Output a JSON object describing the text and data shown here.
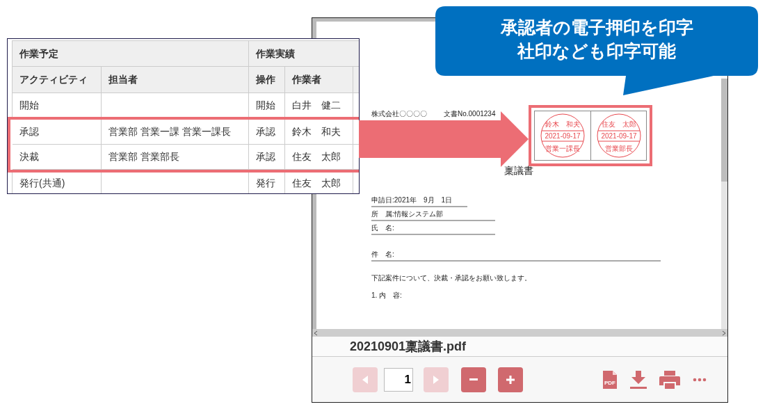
{
  "table": {
    "groups": [
      {
        "label": "作業予定"
      },
      {
        "label": "作業実績"
      }
    ],
    "columns": [
      "アクティビティ",
      "担当者",
      "操作",
      "作業者"
    ],
    "rows": [
      {
        "activity": "開始",
        "operation": "開始",
        "worker": "白井　健二",
        "highlighted": false
      },
      {
        "activity": "承認",
        "assignee": "営業部 営業一課 営業一課長",
        "operation": "承認",
        "worker": "鈴木　和夫",
        "highlighted": true
      },
      {
        "activity": "決裁",
        "assignee": "営業部 営業部長",
        "operation": "承認",
        "worker": "住友　太郎",
        "highlighted": true
      },
      {
        "activity": "発行(共通)",
        "operation": "発行",
        "worker": "住友　太郎",
        "highlighted": false
      }
    ]
  },
  "pdf_viewer": {
    "document": {
      "company": "株式会社〇〇〇〇",
      "doc_no": "文書No.0001234",
      "stamps": [
        {
          "name": "鈴木　和夫",
          "date": "2021-09-17",
          "title": "営業一課長"
        },
        {
          "name": "住友　太郎",
          "date": "2021-09-17",
          "title": "営業部長"
        }
      ],
      "title": "稟議書",
      "fields": [
        {
          "label": "申請日:",
          "value": "2021年　9月　1日"
        },
        {
          "label": "所　属:",
          "value": "情報システム部"
        },
        {
          "label": "氏　名:"
        },
        {
          "label": "件　名:"
        }
      ],
      "body": "下記案件について、決裁・承認をお願い致します。",
      "item": "1. 内　容:"
    },
    "file_name": "20210901稟議書.pdf",
    "page": "1",
    "buttons": [
      {
        "kind": "prev",
        "disabled": true
      },
      {
        "kind": "next",
        "disabled": true
      },
      {
        "kind": "zoom_out",
        "disabled": false
      },
      {
        "kind": "zoom_in",
        "disabled": false
      }
    ],
    "actions": [
      {
        "kind": "pdf",
        "label": "PDF"
      },
      {
        "kind": "download"
      },
      {
        "kind": "print"
      },
      {
        "kind": "more"
      }
    ]
  },
  "callout": {
    "lines": [
      "承認者の電子押印を印字",
      "社印なども印字可能"
    ]
  }
}
